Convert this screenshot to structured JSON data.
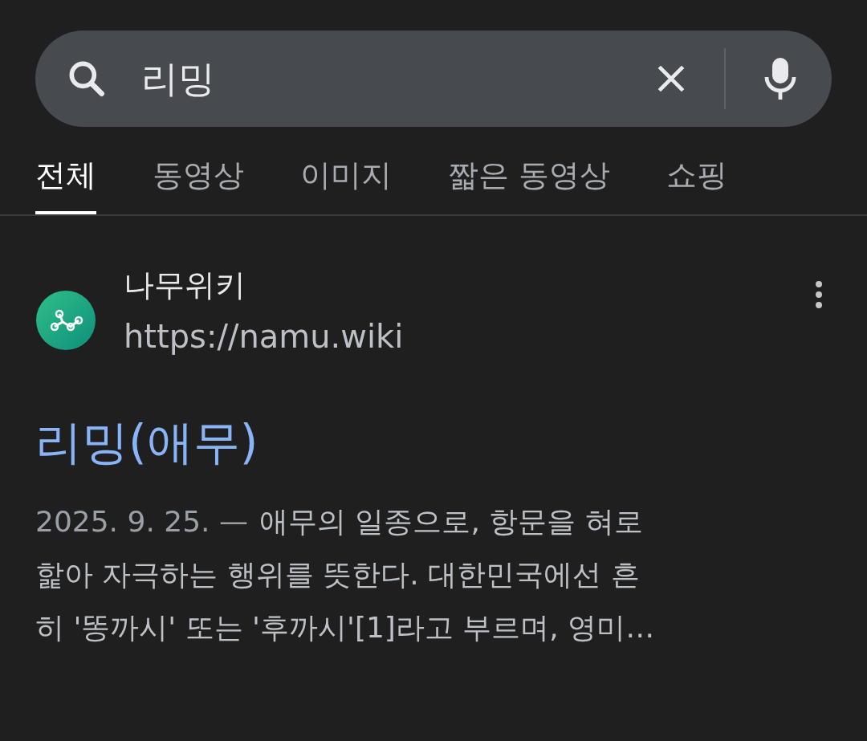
{
  "search": {
    "value": "리밍"
  },
  "tabs": [
    {
      "label": "전체",
      "selected": true
    },
    {
      "label": "동영상",
      "selected": false
    },
    {
      "label": "이미지",
      "selected": false
    },
    {
      "label": "짧은 동영상",
      "selected": false
    },
    {
      "label": "쇼핑",
      "selected": false
    }
  ],
  "result": {
    "site": "나무위키",
    "url": "https://namu.wiki",
    "title": "리밍(애무)",
    "date": "2025. 9. 25. —",
    "snippet_lines": [
      "애무의 일종으로, 항문을 혀로",
      "핥아 자극하는 행위를 뜻한다. 대한민국에선 흔",
      "히 '똥까시' 또는 '후까시'[1]라고 부르며, 영미…"
    ]
  }
}
